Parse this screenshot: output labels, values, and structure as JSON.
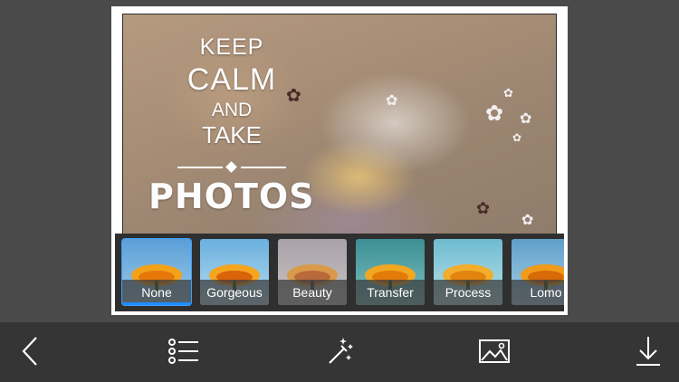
{
  "poster": {
    "line1": "KEEP",
    "line2": "CALM",
    "line3": "AND",
    "line4": "TAKE",
    "line5": "PHOTOS"
  },
  "filters": [
    {
      "label": "None",
      "selected": true,
      "tint": "#6aa7d8"
    },
    {
      "label": "Gorgeous",
      "selected": false,
      "tint": "#79b7dc"
    },
    {
      "label": "Beauty",
      "selected": false,
      "tint": "#a9a3a9"
    },
    {
      "label": "Transfer",
      "selected": false,
      "tint": "#4c9aa0"
    },
    {
      "label": "Process",
      "selected": false,
      "tint": "#7cc2d4"
    },
    {
      "label": "Lomo",
      "selected": false,
      "tint": "#7aaecc"
    }
  ],
  "toolbar": {
    "icons": [
      "back-chevron-icon",
      "list-icon",
      "magic-wand-icon",
      "image-icon",
      "download-icon"
    ]
  },
  "colors": {
    "background": "#4a4a4a",
    "toolbar": "#353535",
    "accent": "#1f8cff"
  }
}
